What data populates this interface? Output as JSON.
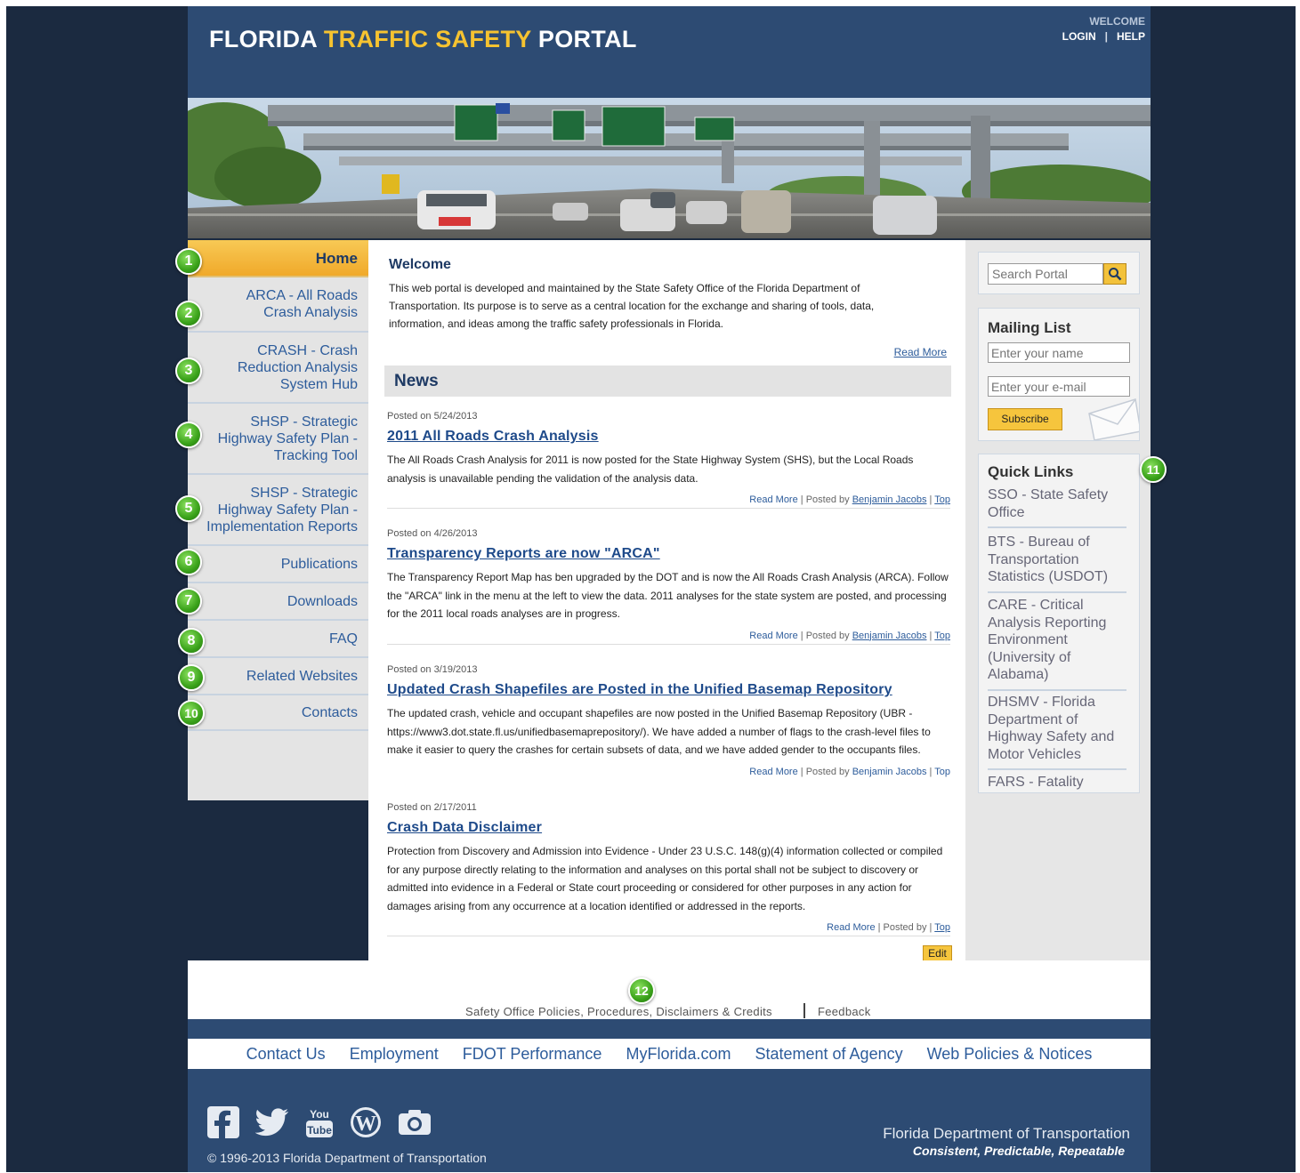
{
  "header": {
    "title_part1": "FLORIDA ",
    "title_part2": "TRAFFIC SAFETY",
    "title_part3": " PORTAL",
    "welcome": "WELCOME",
    "login": "LOGIN",
    "separator": "|",
    "help": "HELP"
  },
  "nav": {
    "items": [
      {
        "badge": "1",
        "label": "Home"
      },
      {
        "badge": "2",
        "label": "ARCA - All Roads Crash Analysis"
      },
      {
        "badge": "3",
        "label": "CRASH - Crash Reduction Analysis System Hub"
      },
      {
        "badge": "4",
        "label": "SHSP - Strategic Highway Safety Plan - Tracking Tool"
      },
      {
        "badge": "5",
        "label": "SHSP - Strategic Highway Safety Plan - Implementation Reports"
      },
      {
        "badge": "6",
        "label": "Publications"
      },
      {
        "badge": "7",
        "label": "Downloads"
      },
      {
        "badge": "8",
        "label": "FAQ"
      },
      {
        "badge": "9",
        "label": "Related Websites"
      },
      {
        "badge": "10",
        "label": "Contacts"
      }
    ]
  },
  "main": {
    "welcome_title": "Welcome",
    "welcome_text": "This web portal is developed and maintained by the State Safety Office of the Florida Department of Transportation. Its purpose is to serve as a central location for the exchange and sharing of tools, data, information, and ideas among the traffic safety professionals in Florida.",
    "welcome_read_more": "Read More",
    "news_title": "News",
    "posts": [
      {
        "date": "Posted on 5/24/2013",
        "title": "2011 All Roads Crash Analysis",
        "body": "The All Roads Crash Analysis for 2011 is now posted for the State Highway System (SHS), but the Local Roads analysis is unavailable pending the validation of the analysis data.",
        "read_more": "Read More",
        "posted_by": "Posted by",
        "author": "Benjamin Jacobs",
        "top": "Top"
      },
      {
        "date": "Posted on 4/26/2013",
        "title": "Transparency Reports are now \"ARCA\"",
        "body": "The Transparency Report Map has ben upgraded by the DOT and is now the All Roads Crash Analysis (ARCA). Follow the \"ARCA\" link in the menu at the left to view the data. 2011 analyses for the state system are posted, and processing for the 2011 local roads analyses are in progress.",
        "read_more": "Read More",
        "posted_by": "Posted by",
        "author": "Benjamin Jacobs",
        "top": "Top"
      },
      {
        "date": "Posted on 3/19/2013",
        "title": "Updated Crash Shapefiles are Posted in the Unified Basemap Repository",
        "body": "The updated crash, vehicle and occupant shapefiles are now posted in the Unified Basemap Repository (UBR - https://www3.dot.state.fl.us/unifiedbasemaprepository/). We have added a number of flags to the crash-level files to make it easier to query the crashes for certain subsets of data, and we have added gender to the occupants files.",
        "read_more": "Read More",
        "posted_by": "Posted by",
        "author": "Benjamin Jacobs",
        "top": "Top"
      },
      {
        "date": "Posted on 2/17/2011",
        "title": "Crash Data Disclaimer",
        "body": "Protection from Discovery and Admission into Evidence - Under 23 U.S.C. 148(g)(4) information collected or compiled for any purpose directly relating to the information and analyses on this portal shall not be subject to discovery or admitted into evidence in a Federal or State court proceeding or considered for other purposes in any action for damages arising from any occurrence at a location identified or addressed in the reports.",
        "read_more": "Read More",
        "posted_by": "Posted by",
        "author": "",
        "top": "Top"
      }
    ],
    "edit_label": "Edit"
  },
  "right": {
    "search_placeholder": "Search Portal",
    "mailing_title": "Mailing List",
    "name_placeholder": "Enter your name",
    "email_placeholder": "Enter your e-mail",
    "subscribe_label": "Subscribe",
    "quick_links_title": "Quick Links",
    "quick_links_badge": "11",
    "quick_links": [
      "SSO - State Safety Office",
      "BTS - Bureau of Transportation Statistics (USDOT)",
      "CARE - Critical Analysis Reporting Environment (University of Alabama)",
      "DHSMV - Florida Department of Highway Safety and Motor Vehicles",
      "FARS - Fatality"
    ]
  },
  "footer": {
    "badge": "12",
    "policies": "Safety Office Policies, Procedures, Disclaimers & Credits",
    "feedback": "Feedback",
    "links": [
      "Contact Us",
      "Employment",
      "FDOT Performance",
      "MyFlorida.com",
      "Statement of Agency",
      "Web Policies & Notices"
    ],
    "social_icons": [
      "facebook-icon",
      "twitter-icon",
      "youtube-icon",
      "wordpress-icon",
      "camera-icon"
    ],
    "copyright": "© 1996-2013 Florida Department of Transportation",
    "agency": "Florida Department of Transportation",
    "tagline": "Consistent, Predictable, Repeatable"
  },
  "colors": {
    "page_bg": "#1b2a40",
    "header_bg": "#2d4b73",
    "accent": "#f6c330",
    "link": "#2d5c9b",
    "badge_green": "#3aa21a"
  }
}
